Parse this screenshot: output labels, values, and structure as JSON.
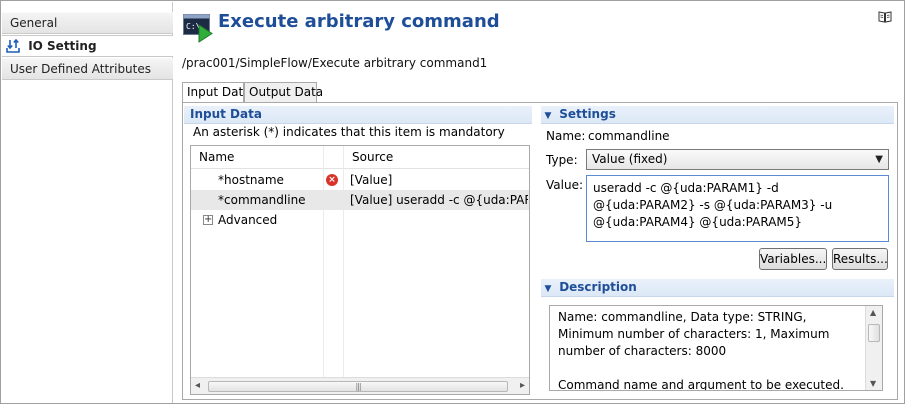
{
  "nav": {
    "items": [
      {
        "label": "General",
        "selected": false
      },
      {
        "label": "IO Setting",
        "selected": true
      },
      {
        "label": "User Defined Attributes",
        "selected": false
      }
    ]
  },
  "header": {
    "title": "Execute arbitrary command",
    "breadcrumb": "/prac001/SimpleFlow/Execute arbitrary command1",
    "title_color": "#1f4e99"
  },
  "tabs": [
    {
      "label": "Input Data",
      "active": true
    },
    {
      "label": "Output Data",
      "active": false
    }
  ],
  "input_data": {
    "heading": "Input Data",
    "hint": "An asterisk (*) indicates that this item is mandatory",
    "columns": [
      "Name",
      "Source"
    ],
    "rows": [
      {
        "name": "*hostname",
        "source": "[Value]",
        "error": true
      },
      {
        "name": "*commandline",
        "source": "[Value] useradd -c @{uda:PARA...",
        "error": false
      },
      {
        "name": "Advanced",
        "source": "",
        "expander": "+"
      }
    ],
    "scroll": {
      "left": "◂",
      "right": "▸",
      "grip": "|||"
    }
  },
  "settings": {
    "heading": "Settings",
    "name_label": "Name:",
    "name_value": "commandline",
    "type_label": "Type:",
    "type_value": "Value (fixed)",
    "value_label": "Value:",
    "value_text": "useradd -c @{uda:PARAM1} -d @{uda:PARAM2} -s @{uda:PARAM3} -u @{uda:PARAM4} @{uda:PARAM5}",
    "variables_button": "Variables...",
    "results_button": "Results..."
  },
  "description": {
    "heading": "Description",
    "line1": "Name: commandline, Data type: STRING, Minimum number of characters: 1, Maximum number of characters: 8000",
    "line2": "Command name and argument to be executed."
  },
  "glyphs": {
    "collapse": "▼",
    "dropdown": "▼",
    "error": "×",
    "up": "▲",
    "down": "▼"
  }
}
